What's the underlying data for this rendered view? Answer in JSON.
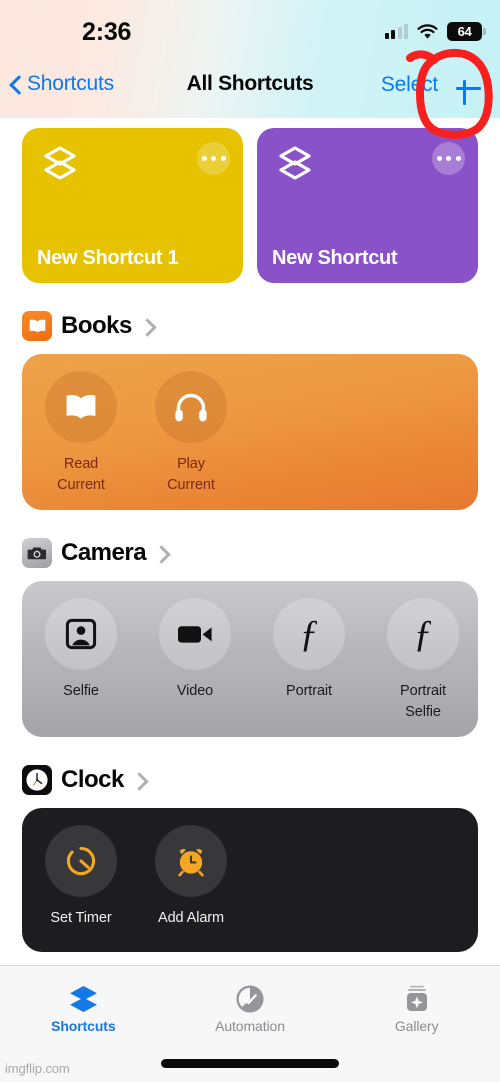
{
  "status_bar": {
    "time": "2:36",
    "signal_icon": "cellular-signal-icon",
    "wifi_icon": "wifi-icon",
    "battery_percent": "64",
    "battery_icon": "battery-icon"
  },
  "nav": {
    "back_label": "Shortcuts",
    "back_icon": "chevron-left-icon",
    "title": "All Shortcuts",
    "select_label": "Select",
    "add_icon": "plus-icon",
    "annotation_icon": "red-circle-annotation"
  },
  "shortcut_cards": [
    {
      "name": "New Shortcut 1",
      "color": "#e6c200",
      "glyph": "shortcuts-layers-icon",
      "more_icon": "ellipsis-icon"
    },
    {
      "name": "New Shortcut",
      "color": "#8a52c8",
      "glyph": "shortcuts-layers-icon",
      "more_icon": "ellipsis-icon"
    }
  ],
  "sections": [
    {
      "title": "Books",
      "app_icon": "books-app-icon",
      "chevron_icon": "chevron-right-icon",
      "actions": [
        {
          "label": "Read Current",
          "icon": "open-book-icon"
        },
        {
          "label": "Play Current",
          "icon": "headphones-icon"
        }
      ]
    },
    {
      "title": "Camera",
      "app_icon": "camera-app-icon",
      "chevron_icon": "chevron-right-icon",
      "actions": [
        {
          "label": "Selfie",
          "icon": "person-portrait-icon"
        },
        {
          "label": "Video",
          "icon": "video-camera-icon"
        },
        {
          "label": "Portrait",
          "icon": "f-stop-icon"
        },
        {
          "label": "Portrait Selfie",
          "icon": "f-stop-icon"
        }
      ]
    },
    {
      "title": "Clock",
      "app_icon": "clock-app-icon",
      "chevron_icon": "chevron-right-icon",
      "actions": [
        {
          "label": "Set Timer",
          "icon": "timer-icon"
        },
        {
          "label": "Add Alarm",
          "icon": "alarm-clock-icon"
        }
      ]
    }
  ],
  "tab_bar": {
    "tabs": [
      {
        "label": "Shortcuts",
        "icon": "shortcuts-layers-icon",
        "active": true
      },
      {
        "label": "Automation",
        "icon": "automation-check-icon",
        "active": false
      },
      {
        "label": "Gallery",
        "icon": "gallery-sparkle-icon",
        "active": false
      }
    ]
  },
  "watermark": "imgflip.com",
  "colors": {
    "accent_blue": "#0b79ef",
    "tab_active": "#1479e4",
    "annotation_red": "#f81f1f",
    "clock_orange": "#f5a623"
  }
}
